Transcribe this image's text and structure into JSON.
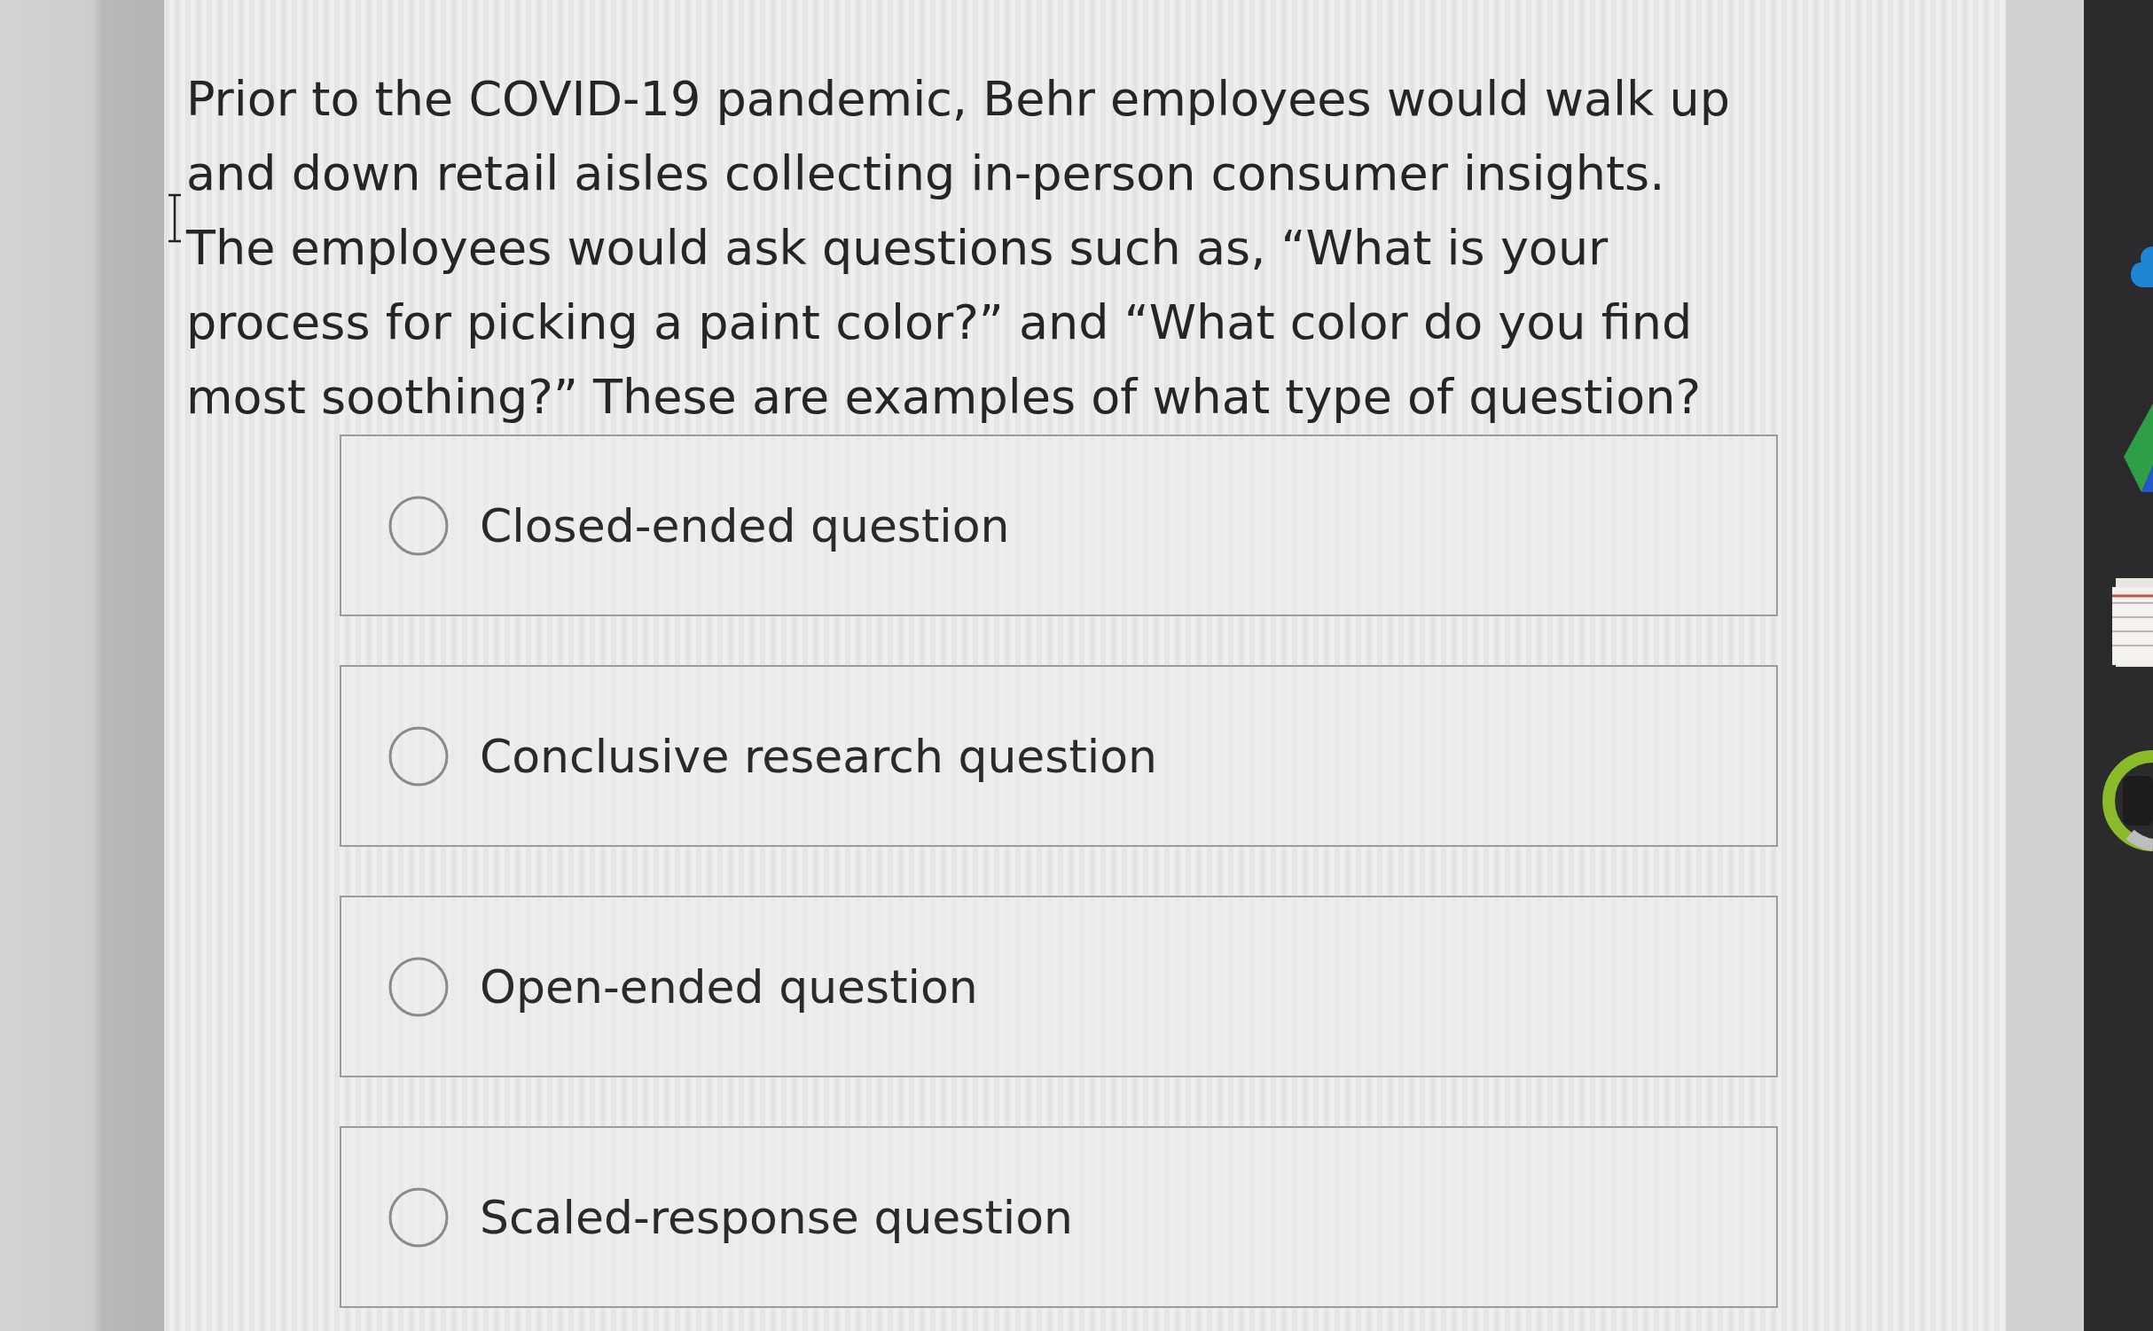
{
  "question": {
    "text": "Prior to the COVID-19 pandemic, Behr employees would walk up\nand down retail aisles collecting in-person consumer insights.\nThe employees would ask questions such as, “What is your\nprocess for picking a paint color?” and “What color do you find\nmost soothing?” These are examples of what type of question?"
  },
  "options": [
    {
      "label": "Closed-ended question",
      "selected": false
    },
    {
      "label": "Conclusive research question",
      "selected": false
    },
    {
      "label": "Open-ended question",
      "selected": false
    },
    {
      "label": "Scaled-response question",
      "selected": false
    }
  ]
}
